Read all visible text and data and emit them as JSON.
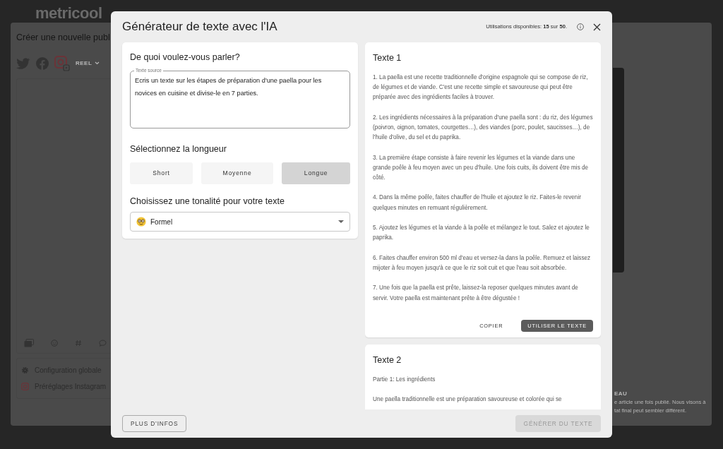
{
  "background": {
    "logo": "metricool",
    "title": "Créer une nouvelle publ",
    "post_type": "REEL",
    "settings": [
      {
        "kind": "gear",
        "label": "Configuration globale"
      },
      {
        "kind": "instagram",
        "label": "Préréglages Instagram"
      }
    ],
    "preview_label": "EAU",
    "preview_note": [
      "e article une fois publié. Nous visons à",
      "tat final peut sembler différent."
    ]
  },
  "dialog": {
    "title": "Générateur de texte avec l'IA",
    "usage": "Utilisations disponibles: **15** sur **50**.",
    "prompt": {
      "heading": "De quoi voulez-vous parler?",
      "source_field": {
        "label": "Texte source",
        "value": "Ecris un texte sur les étapes de préparation d'une paella pour les novices en cuisine et divise-le en 7 parties."
      },
      "length_heading": "Sélectionnez la longueur",
      "length_options": [
        {
          "label": "Short",
          "selected": false
        },
        {
          "label": "Moyenne",
          "selected": false
        },
        {
          "label": "Longue",
          "selected": true
        }
      ],
      "tone_heading": "Choisissez une tonalité pour votre texte",
      "tone": "Formel"
    },
    "results": [
      {
        "title": "Texte 1",
        "paragraphs": [
          "1. La paella est une recette traditionnelle d'origine espagnole qui se compose de riz, de légumes et de viande. C'est une recette simple et savoureuse qui peut être préparée avec des ingrédients faciles à trouver.",
          "2. Les ingrédients nécessaires à la préparation d'une paella sont : du riz, des légumes (poivron, oignon, tomates, courgettes…), des viandes (porc, poulet, saucisses…), de l'huile d'olive, du sel et du paprika.",
          "3. La première étape consiste à faire revenir les légumes et la viande dans une grande poêle à feu moyen avec un peu d'huile. Une fois cuits, ils doivent être mis de côté.",
          "4. Dans la même poêle, faites chauffer de l'huile et ajoutez le riz. Faites-le revenir quelques minutes en remuant régulièrement.",
          "5. Ajoutez les légumes et la viande à la poêle et mélangez le tout. Salez et ajoutez le paprika.",
          "6. Faites chauffer environ 500 ml d'eau et versez-la dans la poêle. Remuez et laissez mijoter à feu moyen jusqu'à ce que le riz soit cuit et que l'eau soit absorbée.",
          "7. Une fois que la paella est prête, laissez-la reposer quelques minutes avant de servir. Votre paella est maintenant prête à être dégustée !"
        ],
        "actions": {
          "copy": "COPIER",
          "use": "UTILISER LE TEXTE"
        }
      },
      {
        "title": "Texte 2",
        "paragraphs": [
          "Partie 1: Les ingrédients",
          "Une paella traditionnelle est une préparation savoureuse et colorée qui se"
        ]
      }
    ],
    "footer": {
      "more_info": "PLUS D’INFOS",
      "generate": {
        "label": "GÉNÉRER DU TEXTE",
        "disabled": true
      }
    }
  }
}
